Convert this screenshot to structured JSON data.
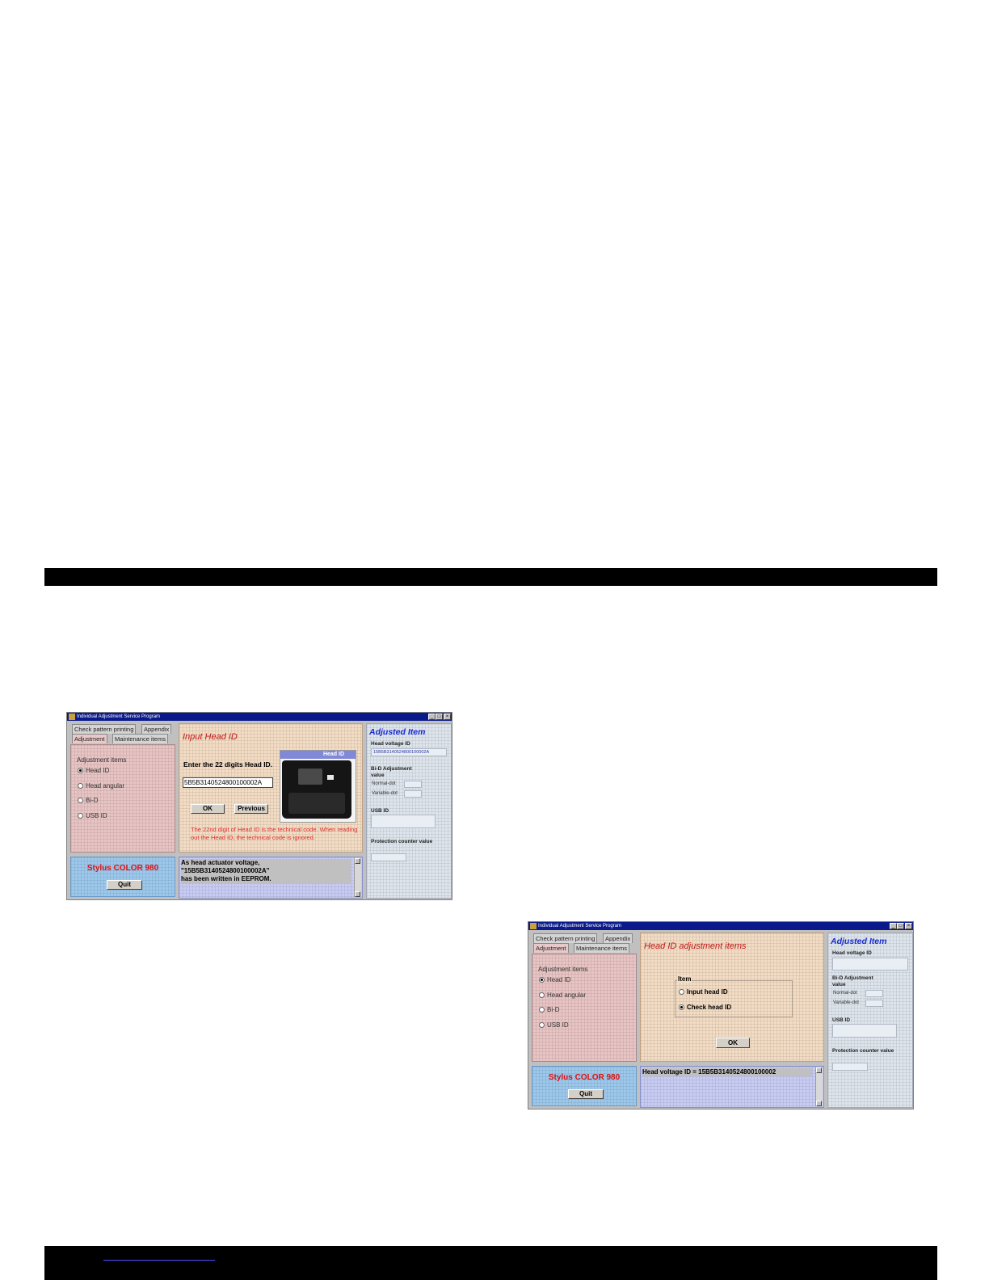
{
  "window_title": "Individual Adjustment Service Program",
  "window_buttons": [
    "_",
    "□",
    "×"
  ],
  "tabs": {
    "check_pattern": "Check pattern printing",
    "appendix": "Appendix",
    "adjustment": "Adjustment",
    "maintenance": "Maintenance items"
  },
  "adjustment_items": {
    "title": "Adjustment items",
    "options": [
      "Head ID",
      "Head angular",
      "Bi-D",
      "USB ID"
    ],
    "selected": "Head ID"
  },
  "model_name": "Stylus COLOR 980",
  "quit_label": "Quit",
  "adjusted_item": {
    "title": "Adjusted Item",
    "head_voltage_label": "Head voltage ID",
    "bid_label": "Bi-D Adjustment value",
    "normal_dot": "Normal-dot",
    "variable_dot": "Variable-dot",
    "usb_label": "USB ID",
    "protection_label": "Protection counter value"
  },
  "dialog1": {
    "heading": "Input Head ID",
    "instruction": "Enter the 22 digits Head ID.",
    "input_value": "5B5B3140524800100002A",
    "ok_label": "OK",
    "previous_label": "Previous",
    "photo_caption": "Head ID",
    "note": "The 22nd digit of Head ID is the technical code. When reading out the Head ID, the technical code is ignored.",
    "head_voltage_value": "15B5B3140524800100002A",
    "log_lines": [
      "As head actuator voltage,",
      "\"15B5B3140524800100002A\"",
      " has been written in EEPROM."
    ]
  },
  "dialog2": {
    "heading": "Head ID adjustment items",
    "item_label": "Item",
    "options": [
      "Input head ID",
      "Check head ID"
    ],
    "selected": "Check head ID",
    "ok_label": "OK",
    "log_line": "Head voltage ID = 15B5B3140524800100002"
  }
}
